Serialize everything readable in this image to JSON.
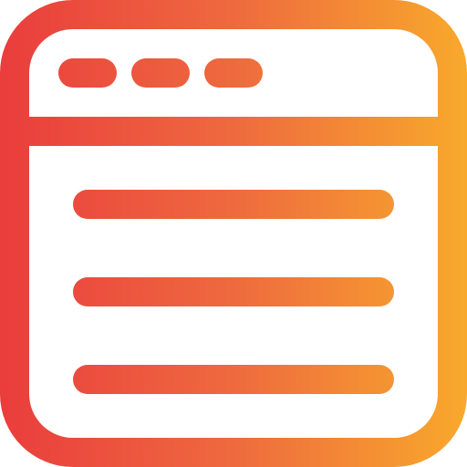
{
  "icon": {
    "name": "browser-window-icon",
    "gradient_start": "#EA3D3D",
    "gradient_mid": "#EE6A3E",
    "gradient_end": "#F8A92C"
  },
  "window": {
    "title_bar_dots": [
      "dot-1",
      "dot-2",
      "dot-3"
    ],
    "content_lines": [
      "line-1",
      "line-2",
      "line-3"
    ]
  }
}
